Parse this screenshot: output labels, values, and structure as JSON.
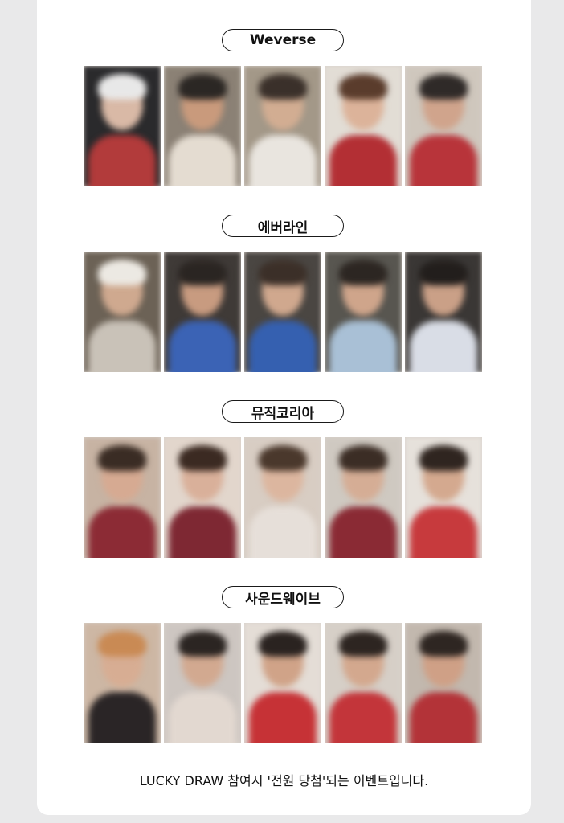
{
  "sections": [
    {
      "label": "Weverse",
      "cards": [
        {
          "bg": "#2a2a2c",
          "hair": "#e8e8e8",
          "skin": "#d9b9a6",
          "cloth": "#b23b3b"
        },
        {
          "bg": "#8b8175",
          "hair": "#2b2724",
          "skin": "#c99a7c",
          "cloth": "#e4dcd1"
        },
        {
          "bg": "#a39888",
          "hair": "#3a302a",
          "skin": "#d2ad92",
          "cloth": "#e9e5df"
        },
        {
          "bg": "#e2ddd5",
          "hair": "#5a3c2c",
          "skin": "#dcb39a",
          "cloth": "#b32f34"
        },
        {
          "bg": "#cfc7bd",
          "hair": "#2f2a28",
          "skin": "#d0a48c",
          "cloth": "#b8343a"
        }
      ]
    },
    {
      "label": "에버라인",
      "cards": [
        {
          "bg": "#6c6256",
          "hair": "#ece9e3",
          "skin": "#cfa98f",
          "cloth": "#c9c2b8"
        },
        {
          "bg": "#3f3a37",
          "hair": "#2a2522",
          "skin": "#c89b80",
          "cloth": "#3b63b5"
        },
        {
          "bg": "#4a4642",
          "hair": "#3b2f28",
          "skin": "#d0a88e",
          "cloth": "#3560b0"
        },
        {
          "bg": "#585650",
          "hair": "#2c2622",
          "skin": "#cfa58b",
          "cloth": "#a9c0d6"
        },
        {
          "bg": "#3a3735",
          "hair": "#221e1c",
          "skin": "#caa087",
          "cloth": "#d9dde6"
        }
      ]
    },
    {
      "label": "뮤직코리아",
      "cards": [
        {
          "bg": "#c7b3a3",
          "hair": "#3a2c24",
          "skin": "#d6aa92",
          "cloth": "#8c2b35"
        },
        {
          "bg": "#e2d6cc",
          "hair": "#3b2a22",
          "skin": "#d9b09a",
          "cloth": "#7e2833"
        },
        {
          "bg": "#d8cdc3",
          "hair": "#4a382c",
          "skin": "#dcb69f",
          "cloth": "#e6dfd9"
        },
        {
          "bg": "#cfc9c1",
          "hair": "#3b2d25",
          "skin": "#d5ad95",
          "cloth": "#8a2a34"
        },
        {
          "bg": "#e6e1db",
          "hair": "#2f2520",
          "skin": "#d4a98f",
          "cloth": "#c73a3d"
        }
      ]
    },
    {
      "label": "사운드웨이브",
      "cards": [
        {
          "bg": "#cdb7a4",
          "hair": "#c98a54",
          "skin": "#d7ad93",
          "cloth": "#2a2526"
        },
        {
          "bg": "#cdc6c1",
          "hair": "#2b2522",
          "skin": "#d2a990",
          "cloth": "#e2d8d0"
        },
        {
          "bg": "#e4ddd6",
          "hair": "#2a2320",
          "skin": "#d0a388",
          "cloth": "#c63236"
        },
        {
          "bg": "#d6cfc7",
          "hair": "#2d2521",
          "skin": "#d3a88e",
          "cloth": "#c3353a"
        },
        {
          "bg": "#c2b8ae",
          "hair": "#2e2622",
          "skin": "#cfa086",
          "cloth": "#b33338"
        }
      ]
    }
  ],
  "footer": "LUCKY DRAW 참여시 '전원 당첨'되는 이벤트입니다."
}
